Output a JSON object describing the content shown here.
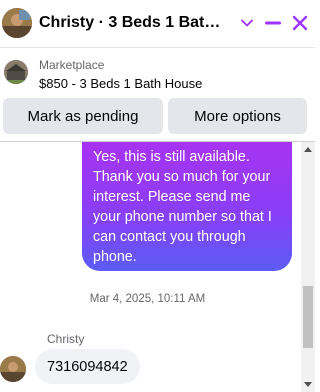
{
  "header": {
    "title": "Christy · 3 Beds 1 Bath House",
    "icons": {
      "avatar": "user-photo",
      "chevron": "chevron-down-icon",
      "minimize": "minimize-icon",
      "close": "close-icon"
    },
    "accent_color": "#a033ff"
  },
  "listing": {
    "category": "Marketplace",
    "title": "$850 - 3 Beds 1 Bath House"
  },
  "actions": {
    "mark_pending_label": "Mark as pending",
    "more_options_label": "More options"
  },
  "messages": {
    "outgoing_text": "Yes, this is still available. Thank you so much for your interest. Please send me your phone number so that I can contact you through phone.",
    "timestamp": "Mar 4, 2025, 10:11 AM",
    "incoming_sender": "Christy",
    "incoming_text": "7316094842"
  },
  "colors": {
    "outgoing_gradient_top": "#a733f2",
    "outgoing_gradient_bottom": "#5b5cf5",
    "incoming_bubble": "#f0f2f5",
    "button_bg": "#e4e6eb"
  }
}
